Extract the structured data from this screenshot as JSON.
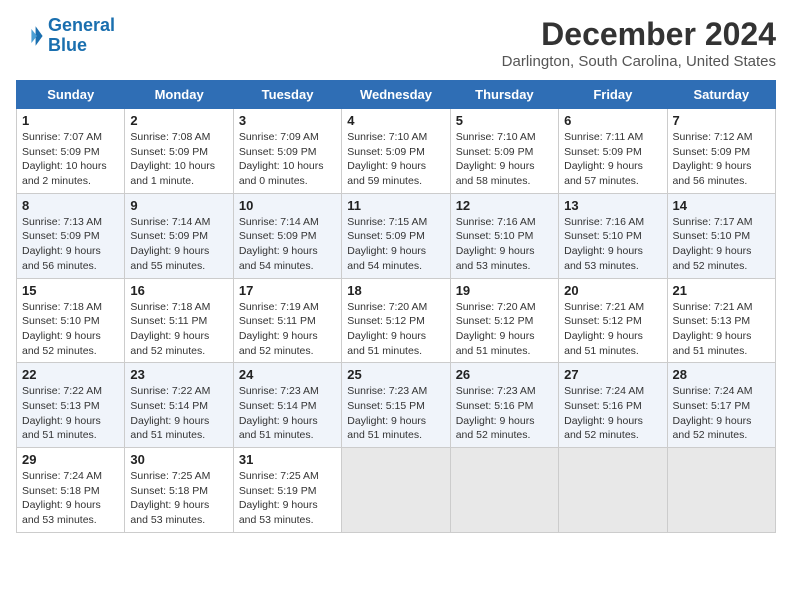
{
  "header": {
    "logo_line1": "General",
    "logo_line2": "Blue",
    "month": "December 2024",
    "location": "Darlington, South Carolina, United States"
  },
  "days_of_week": [
    "Sunday",
    "Monday",
    "Tuesday",
    "Wednesday",
    "Thursday",
    "Friday",
    "Saturday"
  ],
  "weeks": [
    [
      {
        "day": "1",
        "info": "Sunrise: 7:07 AM\nSunset: 5:09 PM\nDaylight: 10 hours\nand 2 minutes."
      },
      {
        "day": "2",
        "info": "Sunrise: 7:08 AM\nSunset: 5:09 PM\nDaylight: 10 hours\nand 1 minute."
      },
      {
        "day": "3",
        "info": "Sunrise: 7:09 AM\nSunset: 5:09 PM\nDaylight: 10 hours\nand 0 minutes."
      },
      {
        "day": "4",
        "info": "Sunrise: 7:10 AM\nSunset: 5:09 PM\nDaylight: 9 hours\nand 59 minutes."
      },
      {
        "day": "5",
        "info": "Sunrise: 7:10 AM\nSunset: 5:09 PM\nDaylight: 9 hours\nand 58 minutes."
      },
      {
        "day": "6",
        "info": "Sunrise: 7:11 AM\nSunset: 5:09 PM\nDaylight: 9 hours\nand 57 minutes."
      },
      {
        "day": "7",
        "info": "Sunrise: 7:12 AM\nSunset: 5:09 PM\nDaylight: 9 hours\nand 56 minutes."
      }
    ],
    [
      {
        "day": "8",
        "info": "Sunrise: 7:13 AM\nSunset: 5:09 PM\nDaylight: 9 hours\nand 56 minutes."
      },
      {
        "day": "9",
        "info": "Sunrise: 7:14 AM\nSunset: 5:09 PM\nDaylight: 9 hours\nand 55 minutes."
      },
      {
        "day": "10",
        "info": "Sunrise: 7:14 AM\nSunset: 5:09 PM\nDaylight: 9 hours\nand 54 minutes."
      },
      {
        "day": "11",
        "info": "Sunrise: 7:15 AM\nSunset: 5:09 PM\nDaylight: 9 hours\nand 54 minutes."
      },
      {
        "day": "12",
        "info": "Sunrise: 7:16 AM\nSunset: 5:10 PM\nDaylight: 9 hours\nand 53 minutes."
      },
      {
        "day": "13",
        "info": "Sunrise: 7:16 AM\nSunset: 5:10 PM\nDaylight: 9 hours\nand 53 minutes."
      },
      {
        "day": "14",
        "info": "Sunrise: 7:17 AM\nSunset: 5:10 PM\nDaylight: 9 hours\nand 52 minutes."
      }
    ],
    [
      {
        "day": "15",
        "info": "Sunrise: 7:18 AM\nSunset: 5:10 PM\nDaylight: 9 hours\nand 52 minutes."
      },
      {
        "day": "16",
        "info": "Sunrise: 7:18 AM\nSunset: 5:11 PM\nDaylight: 9 hours\nand 52 minutes."
      },
      {
        "day": "17",
        "info": "Sunrise: 7:19 AM\nSunset: 5:11 PM\nDaylight: 9 hours\nand 52 minutes."
      },
      {
        "day": "18",
        "info": "Sunrise: 7:20 AM\nSunset: 5:12 PM\nDaylight: 9 hours\nand 51 minutes."
      },
      {
        "day": "19",
        "info": "Sunrise: 7:20 AM\nSunset: 5:12 PM\nDaylight: 9 hours\nand 51 minutes."
      },
      {
        "day": "20",
        "info": "Sunrise: 7:21 AM\nSunset: 5:12 PM\nDaylight: 9 hours\nand 51 minutes."
      },
      {
        "day": "21",
        "info": "Sunrise: 7:21 AM\nSunset: 5:13 PM\nDaylight: 9 hours\nand 51 minutes."
      }
    ],
    [
      {
        "day": "22",
        "info": "Sunrise: 7:22 AM\nSunset: 5:13 PM\nDaylight: 9 hours\nand 51 minutes."
      },
      {
        "day": "23",
        "info": "Sunrise: 7:22 AM\nSunset: 5:14 PM\nDaylight: 9 hours\nand 51 minutes."
      },
      {
        "day": "24",
        "info": "Sunrise: 7:23 AM\nSunset: 5:14 PM\nDaylight: 9 hours\nand 51 minutes."
      },
      {
        "day": "25",
        "info": "Sunrise: 7:23 AM\nSunset: 5:15 PM\nDaylight: 9 hours\nand 51 minutes."
      },
      {
        "day": "26",
        "info": "Sunrise: 7:23 AM\nSunset: 5:16 PM\nDaylight: 9 hours\nand 52 minutes."
      },
      {
        "day": "27",
        "info": "Sunrise: 7:24 AM\nSunset: 5:16 PM\nDaylight: 9 hours\nand 52 minutes."
      },
      {
        "day": "28",
        "info": "Sunrise: 7:24 AM\nSunset: 5:17 PM\nDaylight: 9 hours\nand 52 minutes."
      }
    ],
    [
      {
        "day": "29",
        "info": "Sunrise: 7:24 AM\nSunset: 5:18 PM\nDaylight: 9 hours\nand 53 minutes."
      },
      {
        "day": "30",
        "info": "Sunrise: 7:25 AM\nSunset: 5:18 PM\nDaylight: 9 hours\nand 53 minutes."
      },
      {
        "day": "31",
        "info": "Sunrise: 7:25 AM\nSunset: 5:19 PM\nDaylight: 9 hours\nand 53 minutes."
      },
      {
        "day": "",
        "info": ""
      },
      {
        "day": "",
        "info": ""
      },
      {
        "day": "",
        "info": ""
      },
      {
        "day": "",
        "info": ""
      }
    ]
  ]
}
